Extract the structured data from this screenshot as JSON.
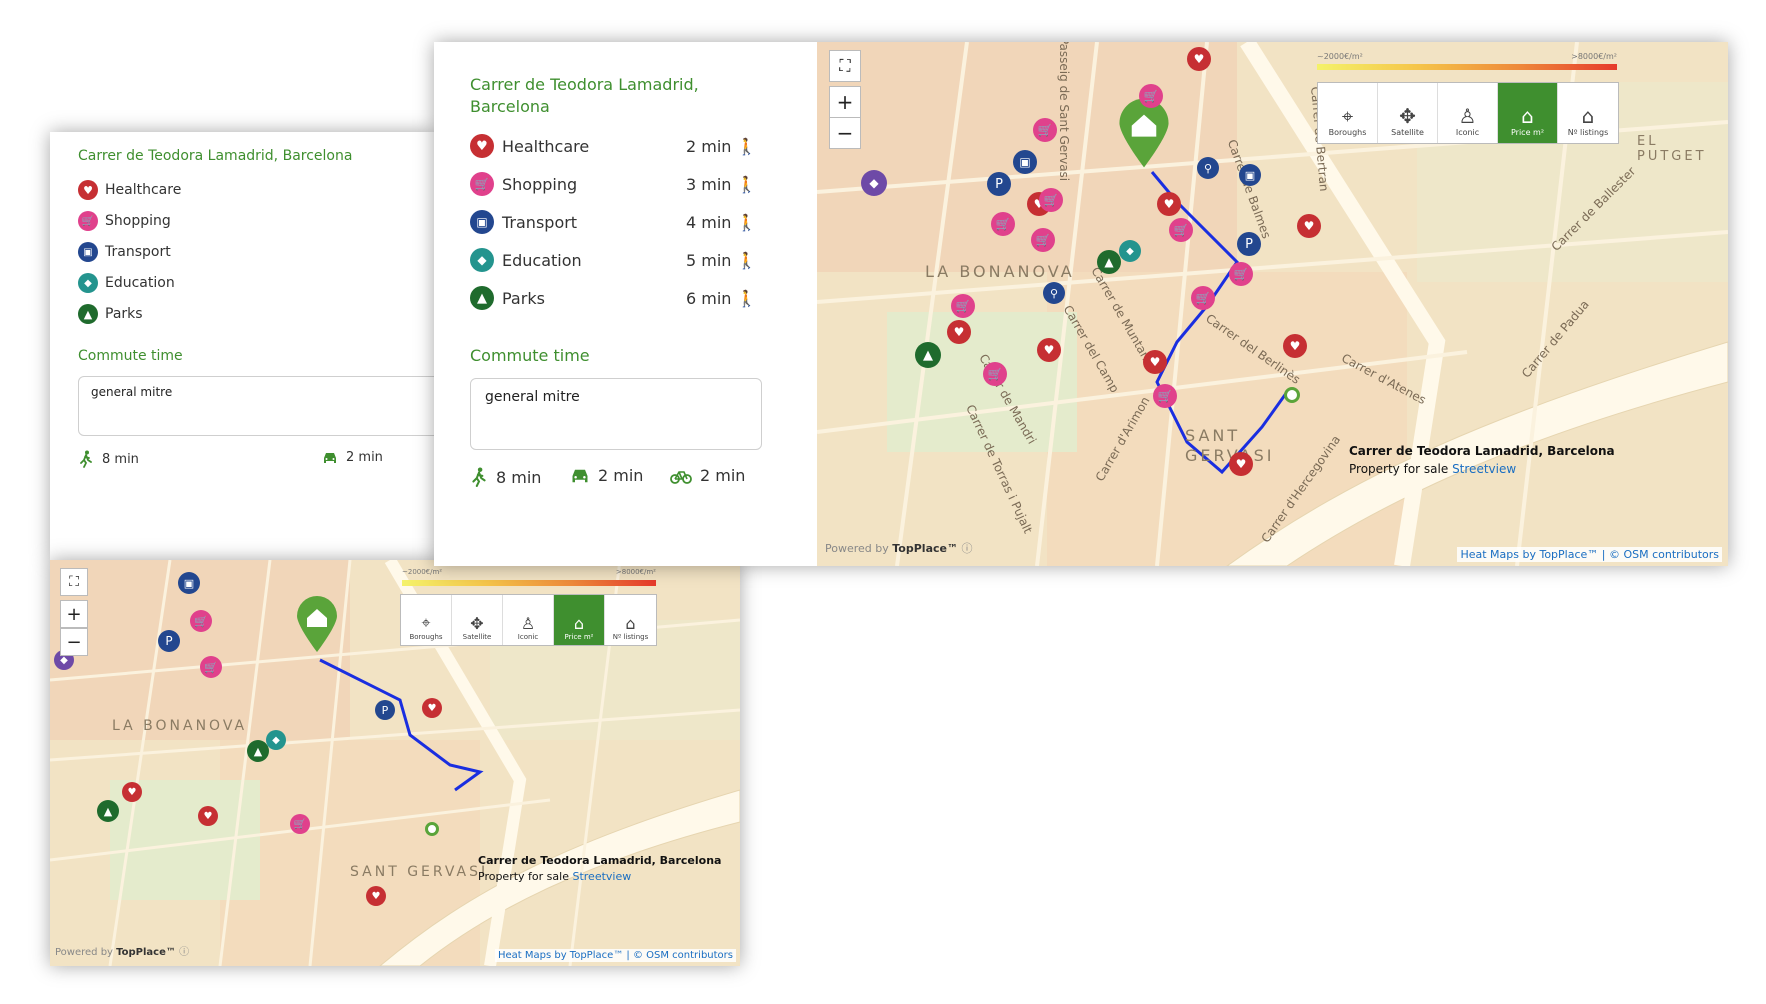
{
  "address": "Carrer de Teodora Lamadrid, Barcelona",
  "address_line1": "Carrer de Teodora Lamadrid,",
  "address_line2": "Barcelona",
  "pois": [
    {
      "label": "Healthcare",
      "time": "2 min",
      "icon": "healthcare-icon",
      "color": "#c62f33"
    },
    {
      "label": "Shopping",
      "time": "3 min",
      "icon": "shopping-icon",
      "color": "#e0418c"
    },
    {
      "label": "Transport",
      "time": "4 min",
      "icon": "bus-icon",
      "color": "#23478f"
    },
    {
      "label": "Education",
      "time": "5 min",
      "icon": "graduation-cap-icon",
      "color": "#24948e"
    },
    {
      "label": "Parks",
      "time": "6 min",
      "icon": "tree-icon",
      "color": "#1f6b2d"
    }
  ],
  "commute": {
    "title": "Commute time",
    "value": "general mitre",
    "walk": "8 min",
    "car": "2 min",
    "bike": "2 min"
  },
  "map": {
    "scale_min": "~2000€/m²",
    "scale_max": ">8000€/m²",
    "layers": [
      {
        "label": "Boroughs",
        "icon": "map-pin-icon",
        "active": false
      },
      {
        "label": "Satellite",
        "icon": "satellite-icon",
        "active": false
      },
      {
        "label": "Iconic",
        "icon": "eiffel-tower-icon",
        "active": false
      },
      {
        "label": "Price m²",
        "icon": "price-house-icon",
        "active": true
      },
      {
        "label": "Nº listings",
        "icon": "chart-house-icon",
        "active": false
      }
    ],
    "neighborhoods": [
      "LA BONANOVA",
      "SANT GERVASI",
      "EL PUTGET"
    ],
    "streets": [
      "Carrer de Balmes",
      "Carrer del Berlinès",
      "Carrer d'Atenes",
      "Carrer de Muntaner",
      "Carrer del Camp",
      "Carrer de Mandri",
      "Carrer de Padua",
      "Carrer de Bertran",
      "Carrer d'Hercegovina",
      "Carrer de Torras i Pujalt",
      "Carrer d'Arimon",
      "Passeig de Sant Gervasi",
      "Carrer de Ballester"
    ],
    "info_title": "Carrer de Teodora Lamadrid, Barcelona",
    "info_sub": "Property for sale",
    "info_link": "Streetview",
    "attribution": "Heat Maps by TopPlace™ | © OSM contributors",
    "powered_by": "Powered by",
    "brand": "TopPlace™",
    "zoom_in": "+",
    "zoom_out": "−"
  }
}
